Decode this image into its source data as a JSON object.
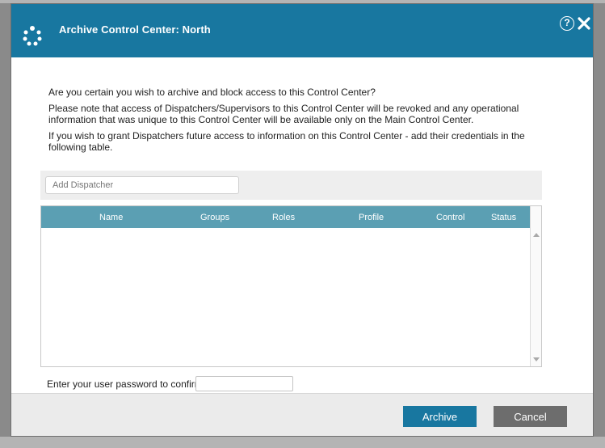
{
  "dialog": {
    "title": "Archive Control Center: North",
    "help_glyph": "?",
    "colors": {
      "header": "#1877a0",
      "grid_header": "#5b9fb3",
      "cancel": "#6d6d6d"
    }
  },
  "message": {
    "line1": "Are you certain you wish to archive and block access to this Control Center?",
    "line2": "Please note that access of Dispatchers/Supervisors to this Control Center will be revoked and any operational information that was unique to this Control Center will be available only on the Main Control Center.",
    "line3": "If you wish to grant Dispatchers future access to information on this Control Center - add their credentials in the following table."
  },
  "add_dispatcher": {
    "placeholder": "Add Dispatcher",
    "value": ""
  },
  "table": {
    "columns": [
      "Name",
      "Groups",
      "Roles",
      "Profile",
      "Control",
      "Status"
    ],
    "rows": []
  },
  "password": {
    "label": "Enter your user password to confirm:",
    "value": ""
  },
  "buttons": {
    "archive": "Archive",
    "cancel": "Cancel"
  },
  "icons": {
    "logo": "app-logo-icon",
    "help": "help-icon",
    "close": "close-icon"
  }
}
